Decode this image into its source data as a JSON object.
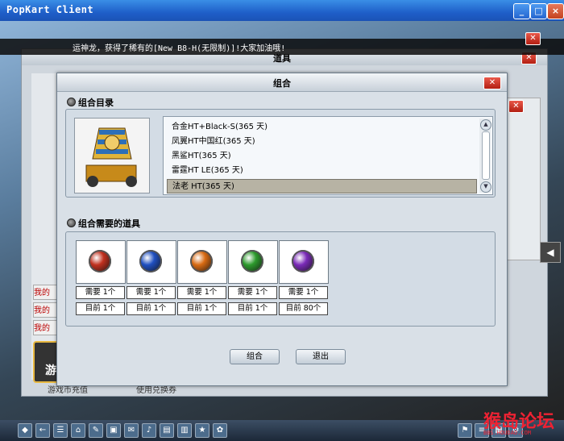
{
  "window": {
    "title": "PopKart Client",
    "min": "_",
    "max": "□",
    "close": "×"
  },
  "ticker": {
    "text": "运神龙，获得了稀有的[New B8-H(无限制)]!大家加油哦!"
  },
  "bg_window": {
    "title": "道具",
    "left_buttons": [
      "我的",
      "我的",
      "我的"
    ],
    "game_button": "游",
    "footer": [
      "游戏币充值",
      "使用兑换券"
    ]
  },
  "dialog": {
    "title": "组合",
    "section_catalog": "组合目录",
    "section_need": "组合需要的道具",
    "catalog_items": [
      {
        "label": "合金HT+Black-S(365 天)",
        "selected": false
      },
      {
        "label": "凤翼HT中国红(365 天)",
        "selected": false
      },
      {
        "label": "黑鲨HT(365 天)",
        "selected": false
      },
      {
        "label": "雷霆HT LE(365 天)",
        "selected": false
      },
      {
        "label": "法老 HT(365 天)",
        "selected": true
      }
    ],
    "required_items": [
      {
        "color": "#c0301e",
        "need": "需要 1个",
        "have": "目前 1个"
      },
      {
        "color": "#1f4fc0",
        "need": "需要 1个",
        "have": "目前 1个"
      },
      {
        "color": "#d86a12",
        "need": "需要 1个",
        "have": "目前 1个"
      },
      {
        "color": "#2c9a2c",
        "need": "需要 1个",
        "have": "目前 1个"
      },
      {
        "color": "#7a2ab8",
        "need": "需要 1个",
        "have": "目前 80个"
      }
    ],
    "combine_button": "组合",
    "exit_button": "退出"
  },
  "watermark": {
    "main": "猴岛论坛",
    "sub": "BBS.HOUDAO.COM"
  },
  "taskbar_icons": [
    "home-icon",
    "back-icon",
    "list-icon",
    "house-icon",
    "tools-icon",
    "bag-icon",
    "mail-icon",
    "music-icon",
    "card-icon",
    "book-icon",
    "stars-icon",
    "chat-icon",
    "flag-icon",
    "menu-icon",
    "grid-icon",
    "gear-icon"
  ]
}
